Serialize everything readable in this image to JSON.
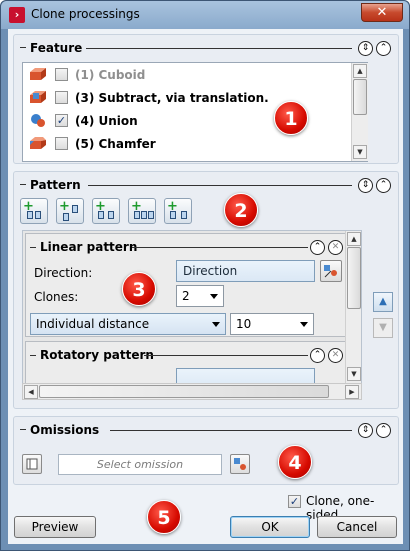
{
  "window": {
    "title": "Clone processings",
    "close_symbol": "✕"
  },
  "feature": {
    "header": "Feature",
    "items": [
      {
        "label": "(1) Cuboid",
        "checked": false,
        "disabled": true,
        "icon": "cuboid-icon"
      },
      {
        "label": "(3) Subtract, via translation.",
        "checked": false,
        "disabled": false,
        "icon": "subtract-icon"
      },
      {
        "label": "(4) Union",
        "checked": true,
        "disabled": false,
        "icon": "union-icon"
      },
      {
        "label": "(5) Chamfer",
        "checked": false,
        "disabled": false,
        "icon": "chamfer-icon"
      }
    ],
    "check_mark": "✓"
  },
  "pattern": {
    "header": "Pattern",
    "toolbar_icons": [
      "add-linear-pattern-icon",
      "add-diagonal-pattern-icon",
      "add-rotatory-pattern-icon",
      "add-rectangular-pattern-icon",
      "add-mirror-pattern-icon"
    ],
    "linear": {
      "title": "Linear pattern",
      "direction_label": "Direction:",
      "direction_value": "Direction",
      "clones_label": "Clones:",
      "clones_value": "2",
      "mode_value": "Individual distance",
      "distance_value": "10"
    },
    "rotatory": {
      "title": "Rotatory pattern"
    }
  },
  "omissions": {
    "header": "Omissions",
    "placeholder": "Select omission"
  },
  "footer": {
    "clone_one_sided_label": "Clone, one-sided",
    "clone_one_sided_checked": true,
    "preview_label": "Preview",
    "ok_label": "OK",
    "cancel_label": "Cancel"
  },
  "badges": [
    "1",
    "2",
    "3",
    "4",
    "5"
  ],
  "colors": {
    "badge": "#d60a00",
    "titlebar": "#a9c3de",
    "section_bg": "#e9edf3",
    "close": "#c74a2d"
  }
}
